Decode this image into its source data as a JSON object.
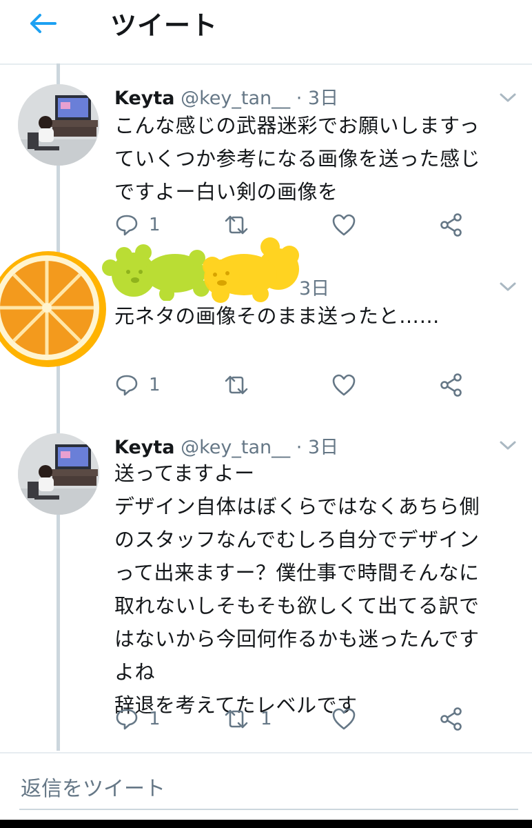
{
  "header": {
    "back_icon": "arrow-left-icon",
    "title": "ツイート"
  },
  "colors": {
    "accent": "#1da1f2",
    "text": "#14171a",
    "secondary": "#657786",
    "line": "#ccd6dd"
  },
  "tweets": [
    {
      "name": "Keyta",
      "handle": "@key_tan__",
      "sep": "·",
      "time": "3日",
      "lines": [
        "こんな感じの武器迷彩でお願いしますっ",
        "ていくつか参考になる画像を送った感じ",
        "ですよー白い剣の画像を"
      ],
      "reply_count": "1",
      "retweet_count": "",
      "like_count": ""
    },
    {
      "name": "",
      "handle": "",
      "sep": "",
      "time": "3日",
      "lines": [
        "元ネタの画像そのまま送ったと……"
      ],
      "reply_count": "1",
      "retweet_count": "",
      "like_count": ""
    },
    {
      "name": "Keyta",
      "handle": "@key_tan__",
      "sep": "·",
      "time": "3日",
      "lines": [
        "送ってますよー",
        "デザイン自体はぼくらではなくあちら側",
        "のスタッフなんでむしろ自分でデザイン",
        "って出来ますー？僕仕事で時間そんなに",
        "取れないしそもそも欲しくて出てる訳で",
        "はないから今回何作るかも迷ったんです",
        "よね",
        "辞退を考えてたレベルです"
      ],
      "reply_count": "1",
      "retweet_count": "1",
      "like_count": ""
    }
  ],
  "reply_bar": {
    "placeholder": "返信をツイート"
  },
  "stickers": [
    "orange-slice-sticker",
    "green-gummy-bear-sticker",
    "yellow-gummy-bear-sticker"
  ]
}
